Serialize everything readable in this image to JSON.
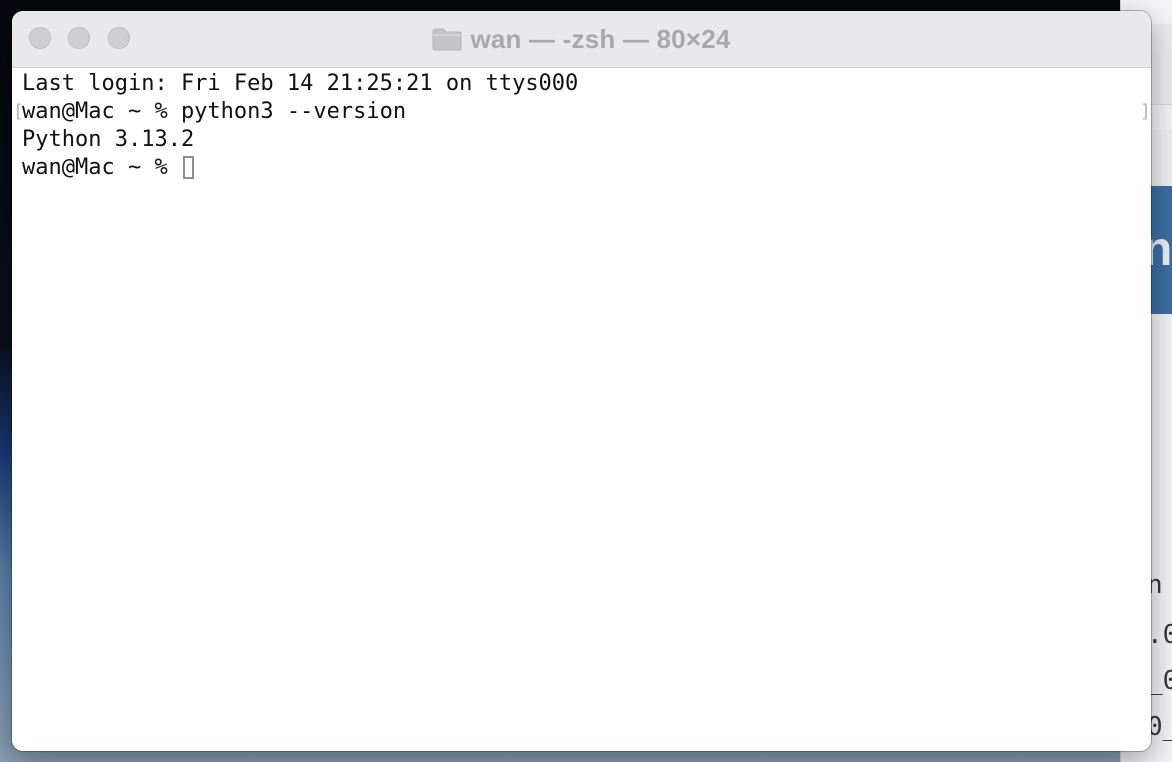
{
  "window": {
    "title": "wan — -zsh — 80×24",
    "folder_icon": "folder-icon"
  },
  "terminal": {
    "lines": [
      "Last login: Fri Feb 14 21:25:21 on ttys000",
      "wan@Mac ~ % python3 --version",
      "Python 3.13.2",
      "wan@Mac ~ % "
    ],
    "cursor": "cursor-block"
  },
  "colors": {
    "titlebar_bg": "#e9e9eb",
    "title_text": "#a8a8ab",
    "terminal_bg": "#ffffff",
    "terminal_text": "#111111",
    "traffic_light_inactive": "#cfcfd1"
  }
}
